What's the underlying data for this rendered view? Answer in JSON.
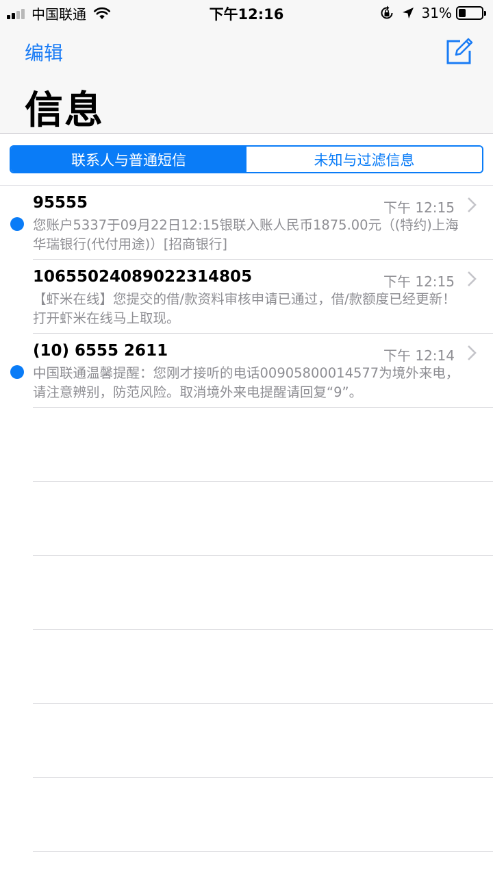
{
  "status_bar": {
    "carrier": "中国联通",
    "time": "下午12:16",
    "battery_percent": "31%",
    "battery_level": 0.31,
    "signal_bars_filled": 2,
    "signal_bars_total": 4
  },
  "header": {
    "edit_label": "编辑",
    "title": "信息",
    "compose_icon": "compose-icon"
  },
  "filter_tabs": [
    {
      "label": "联系人与普通短信",
      "selected": true
    },
    {
      "label": "未知与过滤信息",
      "selected": false
    }
  ],
  "messages": [
    {
      "sender": "95555",
      "time": "下午 12:15",
      "preview": "您账户5337于09月22日12:15银联入账人民币1875.00元（(特约)上海华瑞银行(代付用途)）[招商银行]",
      "unread": true
    },
    {
      "sender": "1065502408902231480​5",
      "time": "下午 12:15",
      "preview": "【虾米在线】您提交的借/款资料审核申请已通过，借/款额度已经更新！打开虾米在线马上取现。",
      "unread": false
    },
    {
      "sender": "(10) 6555 2611",
      "time": "下午 12:14",
      "preview": "中国联通温馨提醒：您刚才接听的电话00905800014577为境外来电，请注意辨别，防范风险。取消境外来电提醒请回复“9”。",
      "unread": true
    }
  ],
  "colors": {
    "accent": "#0a7cf7",
    "link": "#1a7cf5",
    "secondary_text": "#8e8e93",
    "header_bg": "#f7f7f7"
  }
}
